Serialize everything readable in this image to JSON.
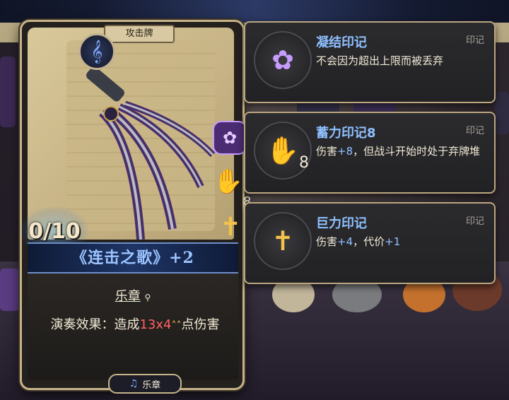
{
  "card": {
    "type_label": "攻击牌",
    "counter": "0/10",
    "seal_count": "8",
    "title": "《连击之歌》+2",
    "keyword": "乐章",
    "effect_prefix": "演奏效果：造成",
    "effect_damage": "13x4",
    "effect_suffix": "点伤害",
    "tag_label": "乐章",
    "colors": {
      "title": "#9cc4ff",
      "damage": "#ff6161"
    }
  },
  "panels": [
    {
      "title": "凝结印记",
      "category": "印记",
      "body": "不会因为超出上限而被丢弃",
      "icon": "brain-sigil-icon"
    },
    {
      "title": "蓄力印记8",
      "category": "印记",
      "number": "8",
      "body_parts": [
        "伤害",
        "+8",
        "，但战斗开始时处于弃牌堆"
      ],
      "icon": "claw-icon"
    },
    {
      "title": "巨力印记",
      "category": "印记",
      "body_parts": [
        "伤害",
        "+4",
        "，代价",
        "+1"
      ],
      "icon": "sword-icon"
    }
  ]
}
